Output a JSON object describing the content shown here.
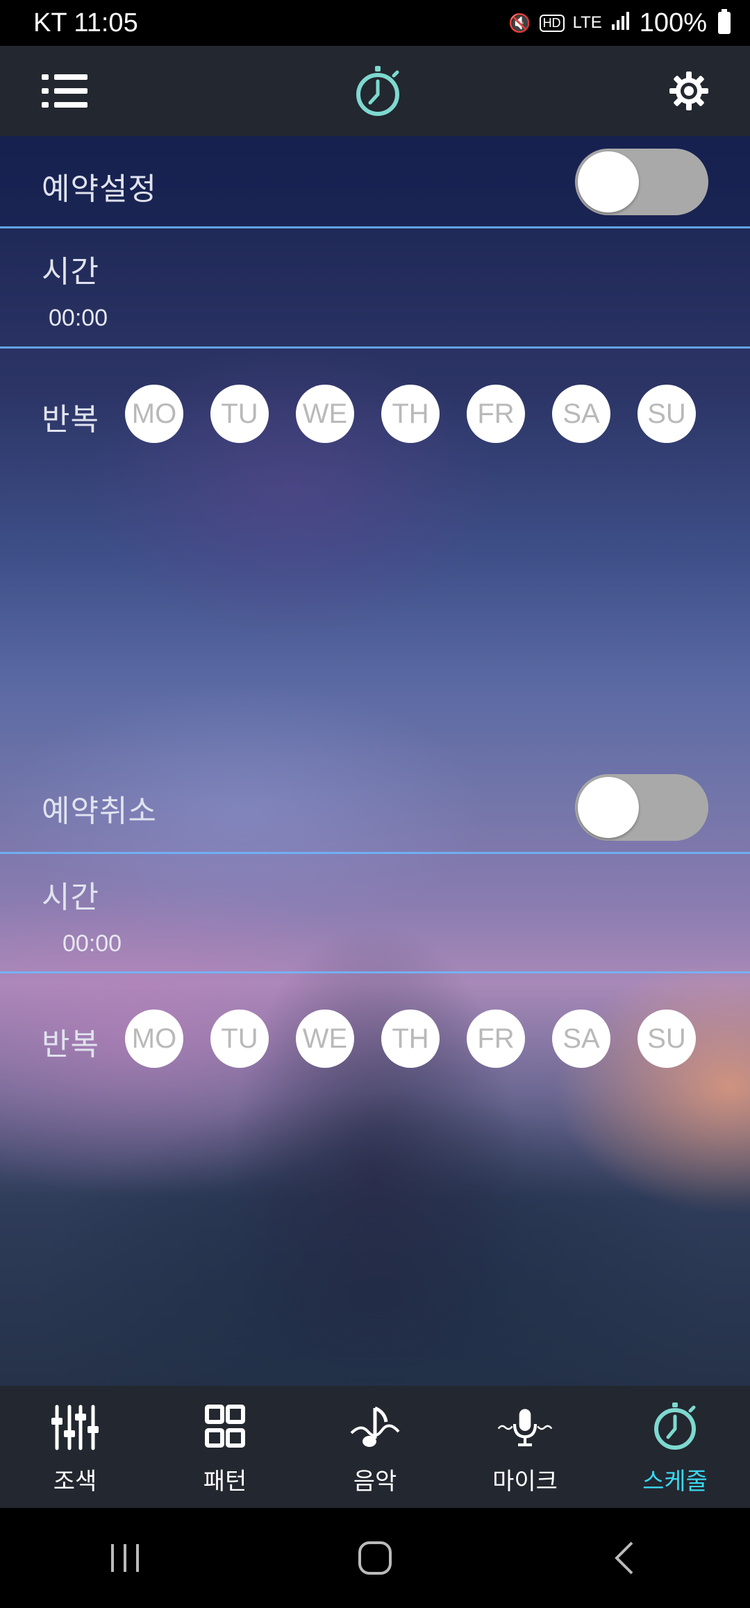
{
  "status_bar": {
    "carrier_time": "KT 11:05",
    "battery": "100%",
    "icons": [
      "mute-icon",
      "hd-icon",
      "lte-icon",
      "signal-icon",
      "battery-icon"
    ]
  },
  "app_bar": {
    "left_icon": "menu-icon",
    "center_icon": "timer-icon",
    "right_icon": "gear-icon"
  },
  "schedule_on": {
    "title": "예약설정",
    "toggle_on": false,
    "time_label": "시간",
    "time_value": "00:00",
    "repeat_label": "반복",
    "days": [
      "MO",
      "TU",
      "WE",
      "TH",
      "FR",
      "SA",
      "SU"
    ]
  },
  "schedule_off": {
    "title": "예약취소",
    "toggle_on": false,
    "time_label": "시간",
    "time_value": "00:00",
    "repeat_label": "반복",
    "days": [
      "MO",
      "TU",
      "WE",
      "TH",
      "FR",
      "SA",
      "SU"
    ]
  },
  "bottom_nav": {
    "items": [
      {
        "label": "조색",
        "icon": "sliders-icon"
      },
      {
        "label": "패턴",
        "icon": "grid-icon"
      },
      {
        "label": "음악",
        "icon": "music-icon"
      },
      {
        "label": "마이크",
        "icon": "microphone-icon"
      },
      {
        "label": "스케줄",
        "icon": "timer-icon",
        "active": true
      }
    ]
  },
  "colors": {
    "accent": "#3ad8f2",
    "divider": "#6fb7ff",
    "bar": "#23272f",
    "toggle_track": "#a9a9a9"
  }
}
